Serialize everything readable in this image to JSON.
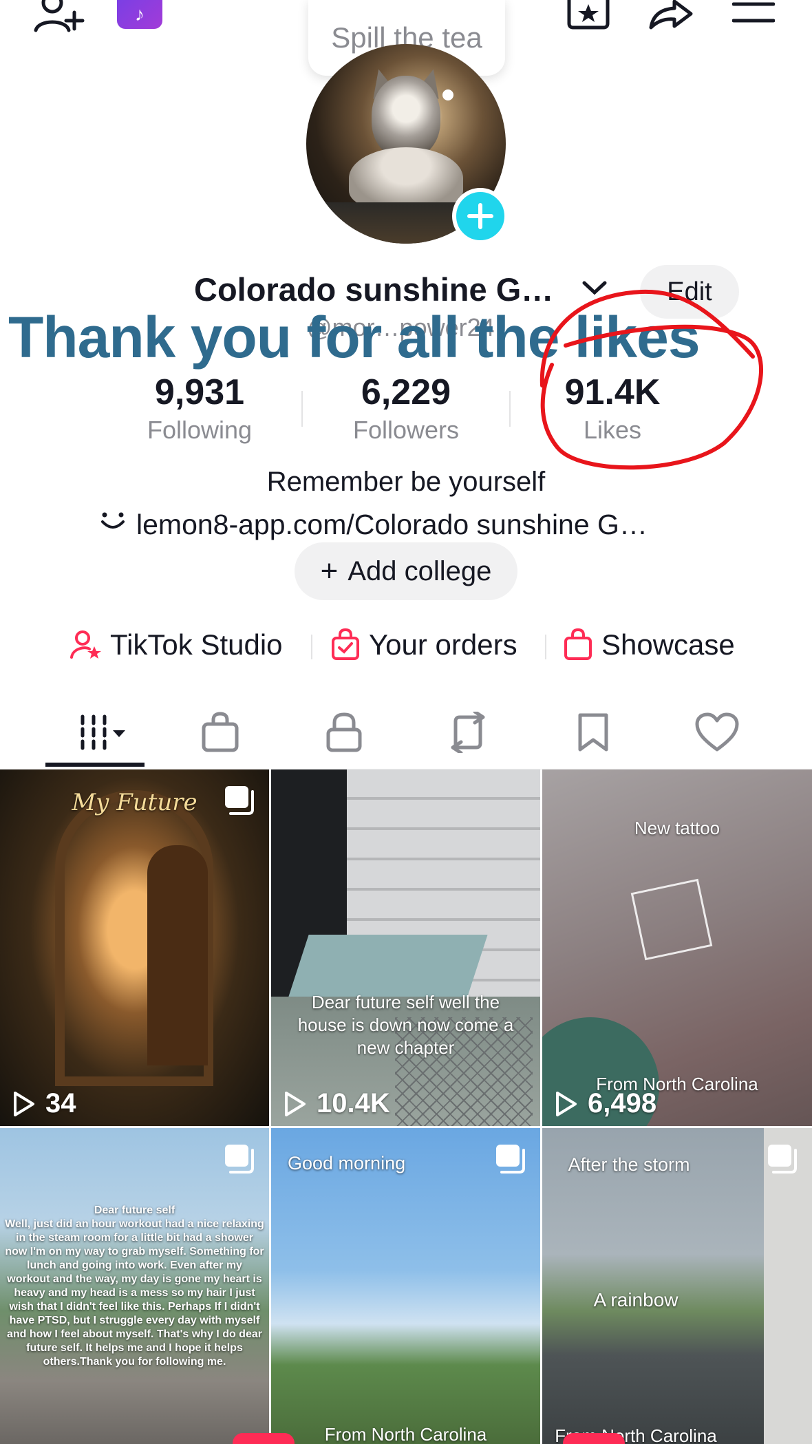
{
  "bubble": {
    "text": "Spill the tea"
  },
  "profile": {
    "display_name": "Colorado sunshine G…",
    "handle": "@mor…power24",
    "edit_label": "Edit",
    "overlay_text": "Thank you for all the likes",
    "bio": "Remember be yourself",
    "link": "lemon8-app.com/Colorado sunshine G…",
    "add_college_label": "Add college",
    "add_college_plus": "+"
  },
  "stats": [
    {
      "value": "9,931",
      "label": "Following"
    },
    {
      "value": "6,229",
      "label": "Followers"
    },
    {
      "value": "91.4K",
      "label": "Likes"
    }
  ],
  "tools": [
    {
      "label": "TikTok Studio",
      "icon": "person-star-icon"
    },
    {
      "label": "Your orders",
      "icon": "bag-check-icon"
    },
    {
      "label": "Showcase",
      "icon": "shopping-bag-icon"
    }
  ],
  "tabs": [
    {
      "name": "videos",
      "icon": "grid-bars-icon",
      "active": true
    },
    {
      "name": "shop",
      "icon": "shopping-bag-icon"
    },
    {
      "name": "private",
      "icon": "lock-icon"
    },
    {
      "name": "reposts",
      "icon": "repost-icon"
    },
    {
      "name": "favorites",
      "icon": "bookmark-icon"
    },
    {
      "name": "liked",
      "icon": "heart-icon"
    }
  ],
  "videos": [
    {
      "views": "34",
      "title": "My Future",
      "caption": "",
      "multi": true
    },
    {
      "views": "10.4K",
      "title": "",
      "caption": "Dear future self well the house is down now come a new chapter",
      "multi": false
    },
    {
      "views": "6,498",
      "title": "New tattoo",
      "caption": "From North Carolina",
      "multi": false
    },
    {
      "views": "",
      "title": "Dear future self",
      "caption": "Well, just did an hour workout had a nice relaxing in the steam room for a little bit had a shower now I'm on my way to grab myself. Something for lunch and going into work. Even after my workout and the way, my day is gone my heart is heavy and my head is a mess so my hair I just wish that I didn't feel like this. Perhaps If I didn't have PTSD, but I struggle every day with myself and how I feel about myself. That's why I do dear future self. It helps me and I hope it helps others.Thank you for following me.",
      "multi": true
    },
    {
      "views": "",
      "title": "Good morning",
      "caption": "From North Carolina",
      "multi": true
    },
    {
      "views": "",
      "title": "After the storm",
      "caption": "A rainbow",
      "footer": "From North Carolina",
      "multi": true
    }
  ],
  "colors": {
    "accent_cyan": "#20d5ec",
    "tiktok_red": "#fe2c55",
    "overlay_blue": "#2f6b8e",
    "annotation_red": "#e8151b"
  }
}
